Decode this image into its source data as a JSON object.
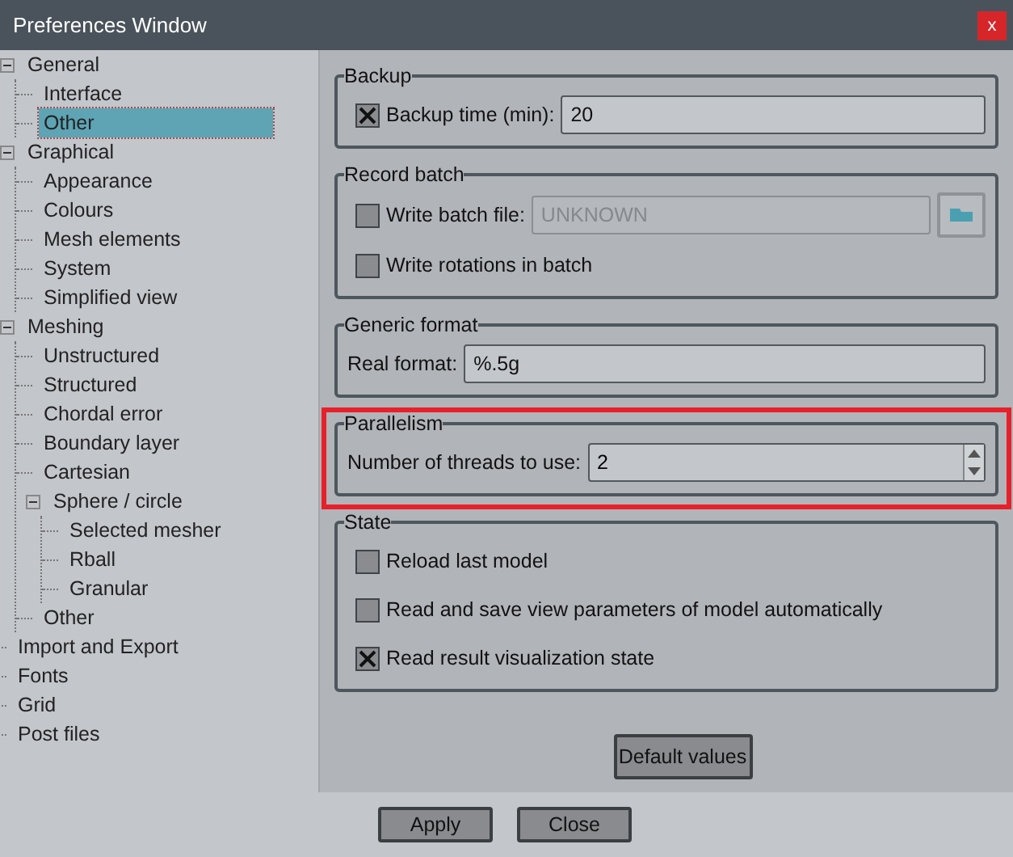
{
  "window": {
    "title": "Preferences Window",
    "close": "x"
  },
  "tree": [
    {
      "label": "General",
      "expanded": true,
      "selected": false,
      "children": [
        {
          "label": "Interface",
          "selected": false
        },
        {
          "label": "Other",
          "selected": true
        }
      ]
    },
    {
      "label": "Graphical",
      "expanded": true,
      "selected": false,
      "children": [
        {
          "label": "Appearance",
          "selected": false
        },
        {
          "label": "Colours",
          "selected": false
        },
        {
          "label": "Mesh elements",
          "selected": false
        },
        {
          "label": "System",
          "selected": false
        },
        {
          "label": "Simplified view",
          "selected": false
        }
      ]
    },
    {
      "label": "Meshing",
      "expanded": true,
      "selected": false,
      "children": [
        {
          "label": "Unstructured",
          "selected": false
        },
        {
          "label": "Structured",
          "selected": false
        },
        {
          "label": "Chordal error",
          "selected": false
        },
        {
          "label": "Boundary layer",
          "selected": false
        },
        {
          "label": "Cartesian",
          "selected": false
        },
        {
          "label": "Sphere / circle",
          "expanded": true,
          "selected": false,
          "children": [
            {
              "label": "Selected mesher",
              "selected": false
            },
            {
              "label": "Rball",
              "selected": false
            },
            {
              "label": "Granular",
              "selected": false
            }
          ]
        },
        {
          "label": "Other",
          "selected": false
        }
      ]
    },
    {
      "label": "Import and Export",
      "selected": false
    },
    {
      "label": "Fonts",
      "selected": false
    },
    {
      "label": "Grid",
      "selected": false
    },
    {
      "label": "Post files",
      "selected": false
    }
  ],
  "groups": [
    {
      "title": "Backup",
      "highlighted": false,
      "rows": [
        {
          "kind": "checkbox_field",
          "label": "Backup time (min):",
          "checked": true,
          "value": "20"
        }
      ]
    },
    {
      "title": "Record batch",
      "highlighted": false,
      "rows": [
        {
          "kind": "checkbox_file",
          "label": "Write batch file:",
          "checked": false,
          "value": "UNKNOWN",
          "disabled": true
        },
        {
          "kind": "checkbox",
          "label": "Write rotations in batch",
          "checked": false
        }
      ]
    },
    {
      "title": "Generic format",
      "highlighted": false,
      "rows": [
        {
          "kind": "field",
          "label": "Real format:",
          "value": "%.5g"
        }
      ]
    },
    {
      "title": "Parallelism",
      "highlighted": true,
      "rows": [
        {
          "kind": "spinner",
          "label": "Number of threads to use:",
          "value": "2"
        }
      ]
    },
    {
      "title": "State",
      "highlighted": false,
      "rows": [
        {
          "kind": "checkbox",
          "label": "Reload last model",
          "checked": false
        },
        {
          "kind": "checkbox",
          "label": "Read and save view parameters of model automatically",
          "checked": false
        },
        {
          "kind": "checkbox",
          "label": "Read result visualization state",
          "checked": true
        }
      ]
    }
  ],
  "default_button": "Default values",
  "buttons": [
    "Apply",
    "Close"
  ]
}
